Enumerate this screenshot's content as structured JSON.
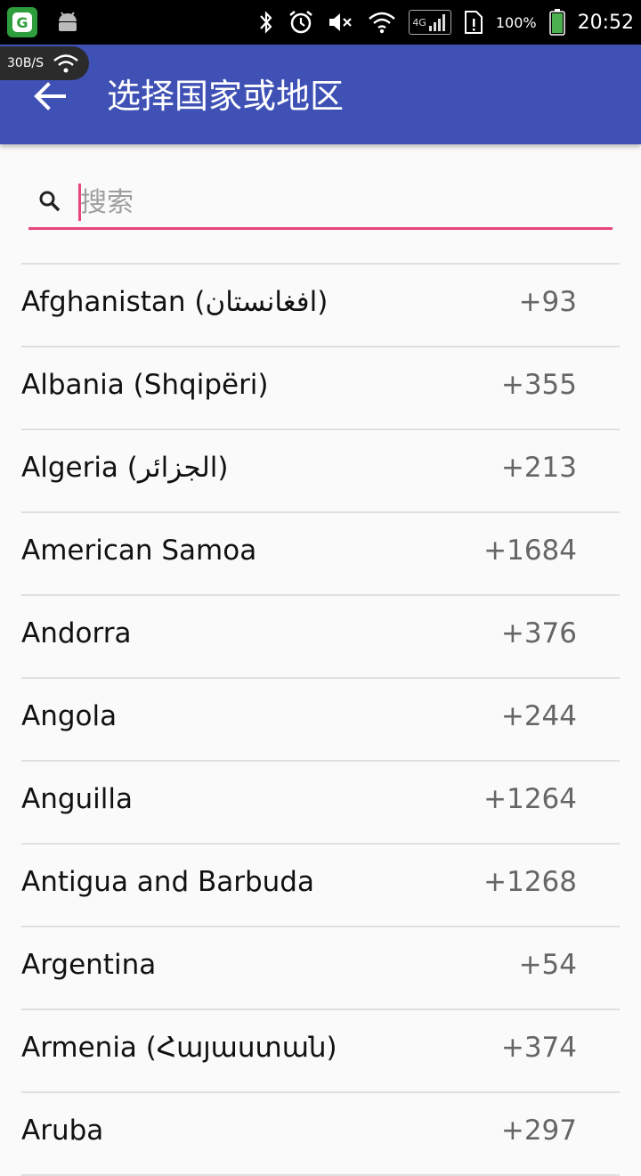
{
  "status_bar": {
    "net_type": "4G",
    "battery": "100%",
    "time": "20:52",
    "speed": "30B/S"
  },
  "appbar": {
    "title": "选择国家或地区"
  },
  "search": {
    "placeholder": "搜索",
    "value": ""
  },
  "countries": [
    {
      "name": "Afghanistan (افغانستان)",
      "code": "+93"
    },
    {
      "name": "Albania (Shqipëri)",
      "code": "+355"
    },
    {
      "name": "Algeria (الجزائر)",
      "code": "+213"
    },
    {
      "name": "American Samoa",
      "code": "+1684"
    },
    {
      "name": "Andorra",
      "code": "+376"
    },
    {
      "name": "Angola",
      "code": "+244"
    },
    {
      "name": "Anguilla",
      "code": "+1264"
    },
    {
      "name": "Antigua and Barbuda",
      "code": "+1268"
    },
    {
      "name": "Argentina",
      "code": "+54"
    },
    {
      "name": "Armenia (Հայաստան)",
      "code": "+374"
    },
    {
      "name": "Aruba",
      "code": "+297"
    }
  ],
  "colors": {
    "appbar": "#3f51b5",
    "accent": "#e8457f"
  }
}
